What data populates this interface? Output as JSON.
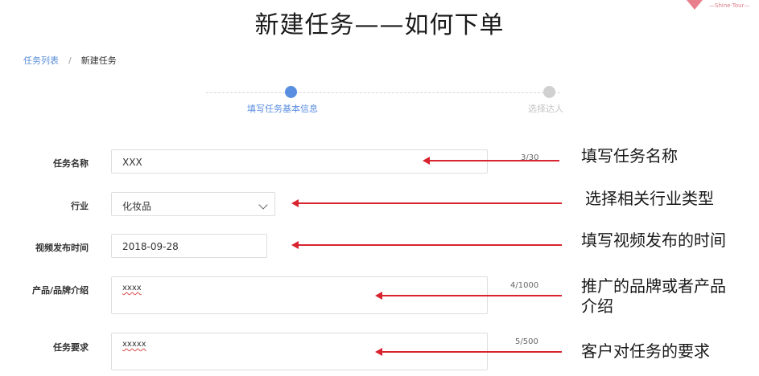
{
  "slide": {
    "title": "新建任务——如何下单"
  },
  "logo": {
    "text": "—Shine·Tour—",
    "color": "#e97f8a"
  },
  "breadcrumb": {
    "parent": "任务列表",
    "separator": "/",
    "current": "新建任务"
  },
  "steps": [
    {
      "label": "填写任务基本信息",
      "active": true,
      "color": "#5a8ee0"
    },
    {
      "label": "选择达人",
      "active": false,
      "color": "#d0d0d0"
    }
  ],
  "form": {
    "task_name": {
      "label": "任务名称",
      "value": "XXX",
      "counter": "3/30"
    },
    "industry": {
      "label": "行业",
      "value": "化妆品"
    },
    "publish_time": {
      "label": "视频发布时间",
      "value": "2018-09-28"
    },
    "brand_intro": {
      "label": "产品/品牌介绍",
      "value": "xxxx",
      "counter": "4/1000"
    },
    "requirements": {
      "label": "任务要求",
      "value": "xxxxx",
      "counter": "5/500"
    }
  },
  "annotations": {
    "task_name": "填写任务名称",
    "industry": "选择相关行业类型",
    "publish_time": "填写视频发布的时间",
    "brand_intro_line1": "推广的品牌或者产品",
    "brand_intro_line2": "介绍",
    "requirements": "客户对任务的要求"
  },
  "colors": {
    "arrow": "#d9232f",
    "link": "#5b8fd8",
    "spellcheck": "#e04848"
  }
}
